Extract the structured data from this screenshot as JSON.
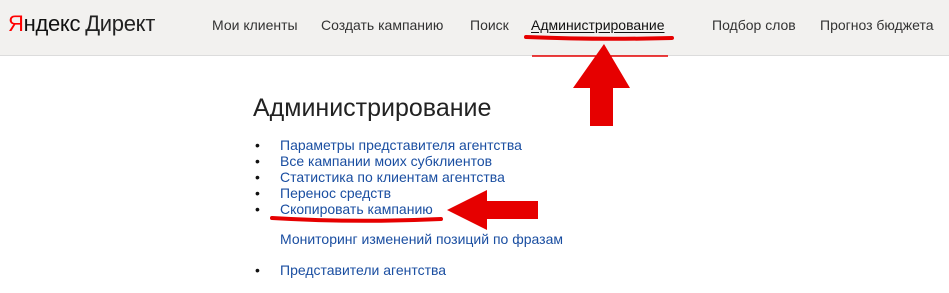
{
  "header": {
    "logo": {
      "brand_first": "Я",
      "brand_rest": "ндекс",
      "product": "Директ"
    },
    "nav": [
      {
        "label": "Мои клиенты"
      },
      {
        "label": "Создать кампанию"
      },
      {
        "label": "Поиск"
      },
      {
        "label": "Администрирование",
        "active": true
      },
      {
        "label": "Подбор слов"
      },
      {
        "label": "Прогноз бюджета"
      }
    ]
  },
  "main": {
    "title": "Администрирование",
    "links": [
      {
        "label": "Параметры представителя агентства"
      },
      {
        "label": "Все кампании моих субклиентов"
      },
      {
        "label": "Статистика по клиентам агентства"
      },
      {
        "label": "Перенос средств"
      },
      {
        "label": "Скопировать кампанию"
      }
    ],
    "extra_link": "Мониторинг изменений позиций по фразам",
    "last_link": "Представители агентства"
  },
  "colors": {
    "link": "#1a4ea1",
    "header_bg": "#f2f1ef",
    "annotation": "#e60000"
  }
}
